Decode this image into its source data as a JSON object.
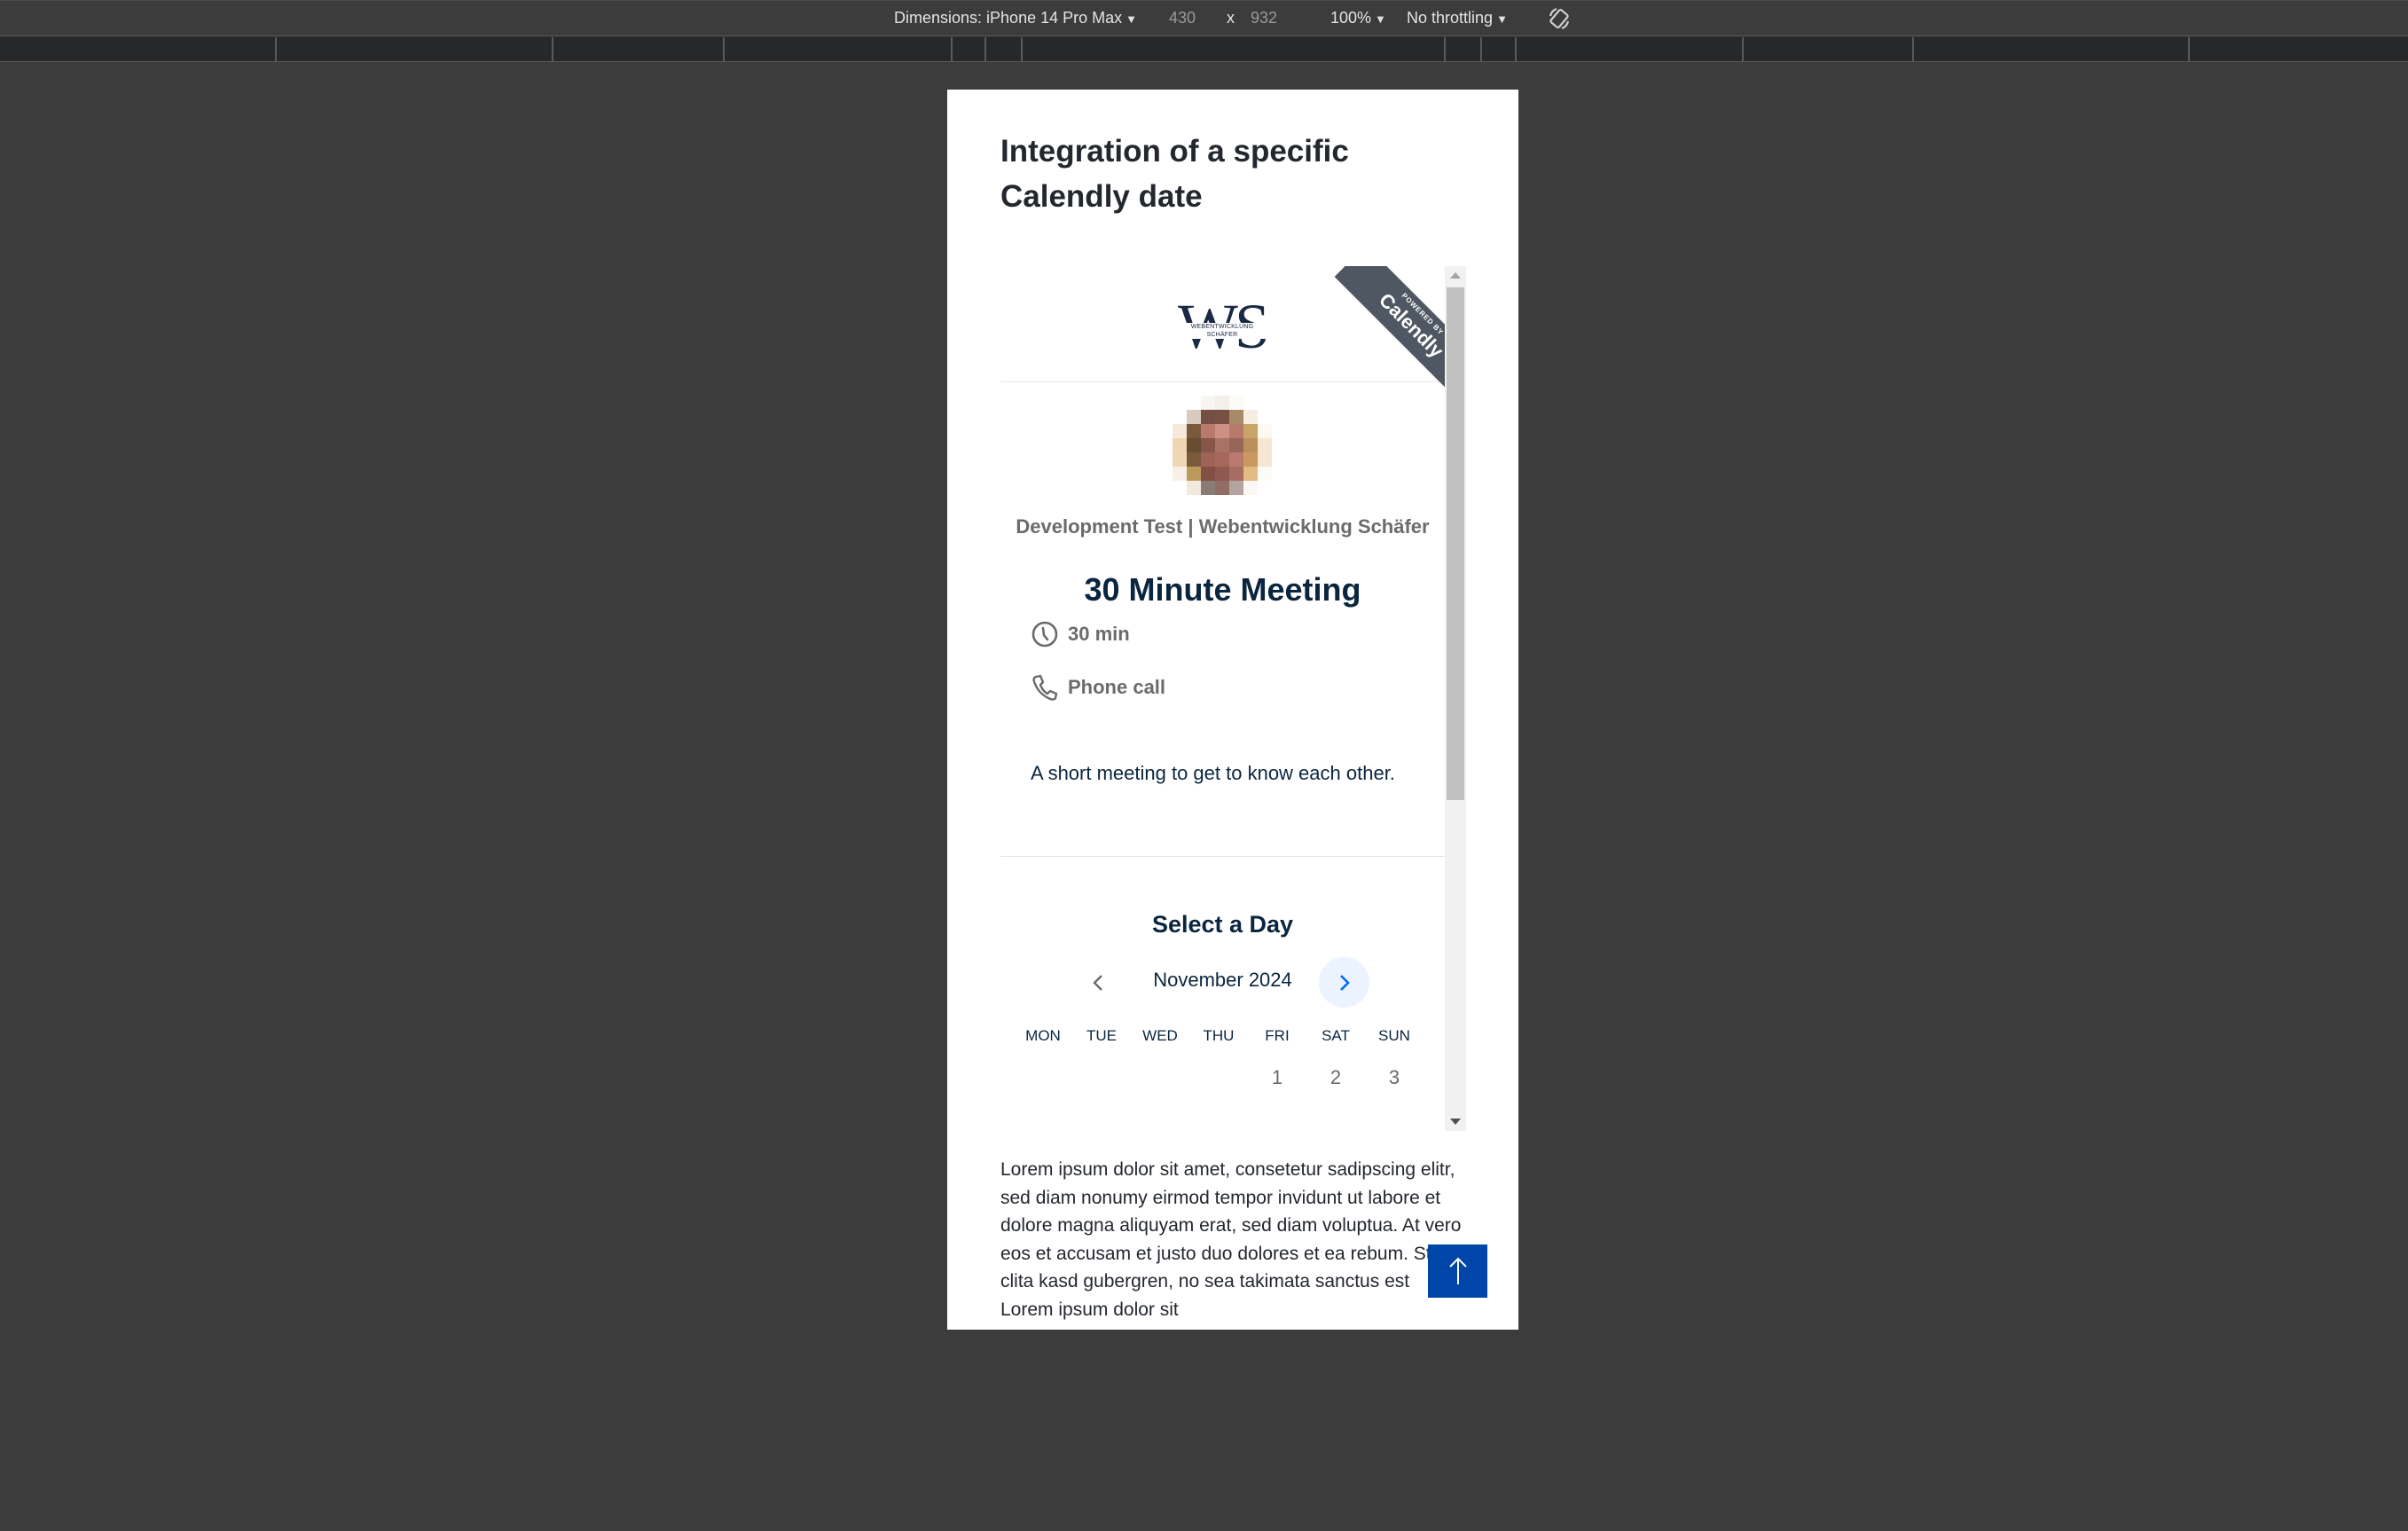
{
  "devtools": {
    "dimensions_label": "Dimensions: iPhone 14 Pro Max",
    "width_value": "430",
    "times_sign": "x",
    "height_value": "932",
    "zoom_label": "100%",
    "throttling_label": "No throttling",
    "rotate_icon": "rotate-icon"
  },
  "page": {
    "title": "Integration of a specific Calendly date",
    "body_text": "Lorem ipsum dolor sit amet, consetetur sadipscing elitr, sed diam nonumy eirmod tempor invidunt ut labore et dolore magna aliquyam erat, sed diam voluptua. At vero eos et accusam et justo duo dolores et ea rebum. Stet clita kasd gubergren, no sea takimata sanctus est Lorem ipsum dolor sit",
    "scroll_top_icon": "arrow-up-icon",
    "accent_color": "#0046a8"
  },
  "calendly": {
    "logo_letters": "WS",
    "logo_subtitle": "WEBENTWICKLUNG SCHÄFER",
    "ribbon_small": "POWERED BY",
    "ribbon_big": "Calendly",
    "host_name": "Development Test | Webentwicklung Schäfer",
    "event_name": "30 Minute Meeting",
    "duration": "30 min",
    "location": "Phone call",
    "description": "A short meeting to get to know each other.",
    "select_day_heading": "Select a Day",
    "month": "November 2024",
    "weekdays": [
      "MON",
      "TUE",
      "WED",
      "THU",
      "FRI",
      "SAT",
      "SUN"
    ],
    "days": [
      "",
      "",
      "",
      "",
      "1",
      "2",
      "3"
    ],
    "brand_color": "#0069ff",
    "heading_color": "#0a2540"
  }
}
